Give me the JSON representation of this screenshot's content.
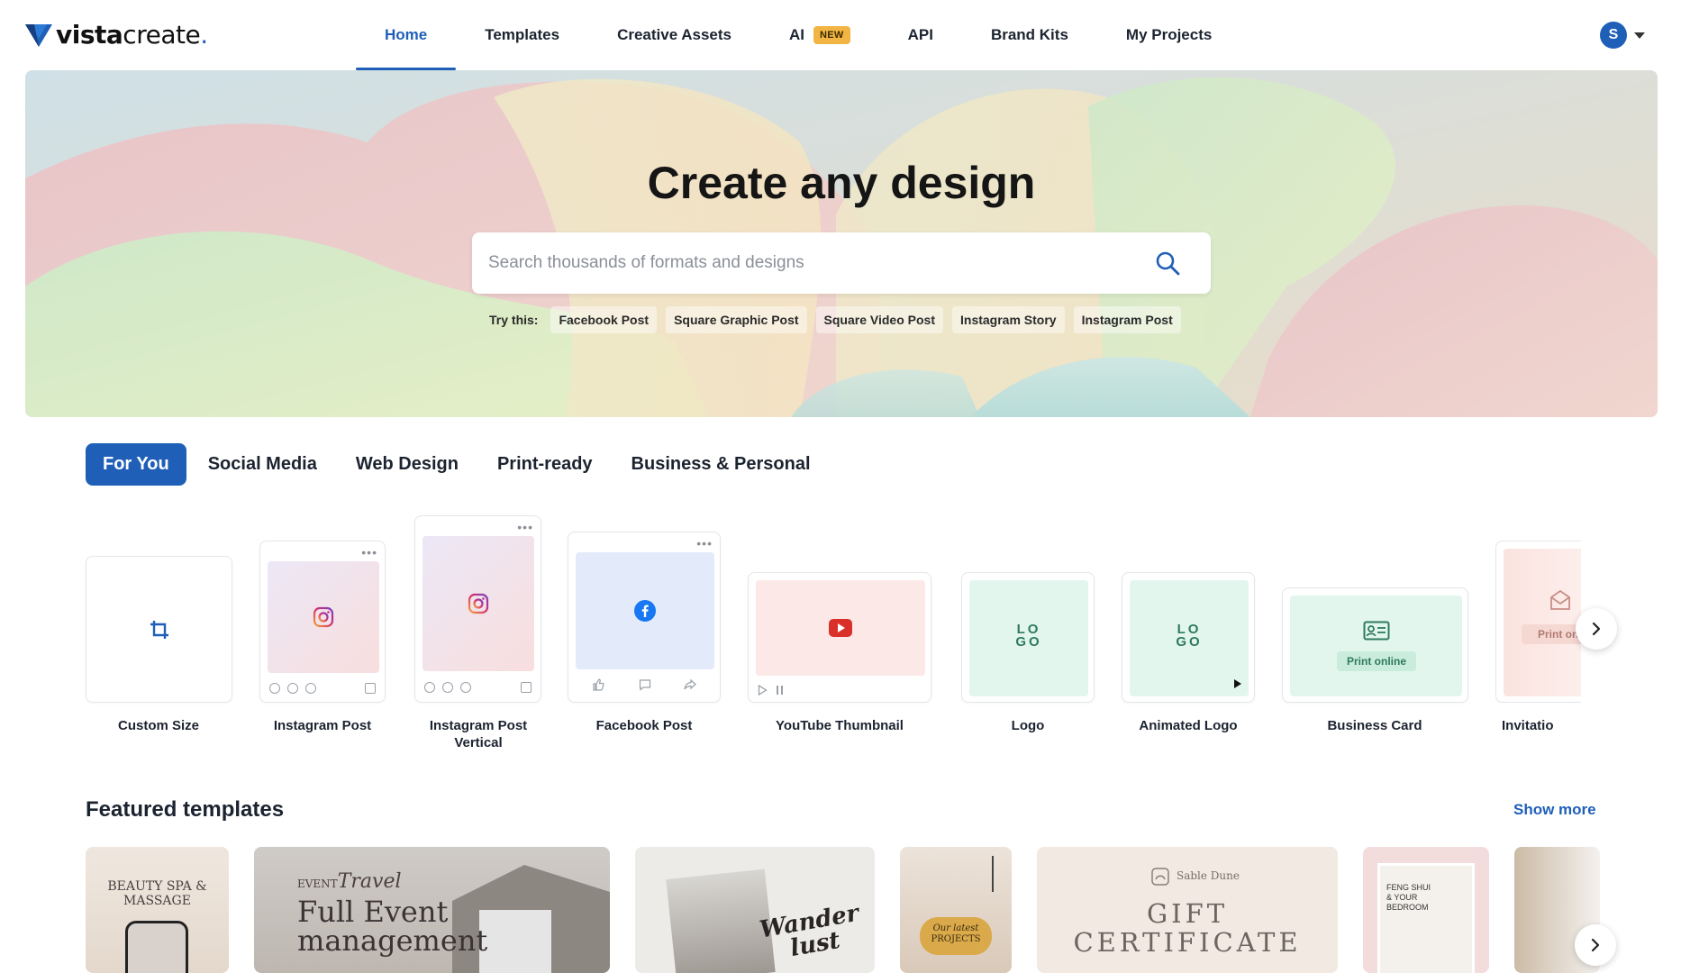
{
  "brand": {
    "name_bold": "vista",
    "name_light": "create",
    "name_dot": "."
  },
  "nav": {
    "items": [
      {
        "label": "Home",
        "active": true
      },
      {
        "label": "Templates"
      },
      {
        "label": "Creative Assets"
      },
      {
        "label": "AI",
        "badge": "NEW"
      },
      {
        "label": "API"
      },
      {
        "label": "Brand Kits"
      },
      {
        "label": "My Projects"
      }
    ]
  },
  "user": {
    "initial": "S"
  },
  "hero": {
    "title": "Create any design",
    "search_placeholder": "Search thousands of formats and designs",
    "try_label": "Try this:",
    "suggestions": [
      "Facebook Post",
      "Square Graphic Post",
      "Square Video Post",
      "Instagram Story",
      "Instagram Post"
    ]
  },
  "categories": {
    "tabs": [
      {
        "label": "For You",
        "active": true
      },
      {
        "label": "Social Media"
      },
      {
        "label": "Web Design"
      },
      {
        "label": "Print-ready"
      },
      {
        "label": "Business & Personal"
      }
    ]
  },
  "formats": [
    {
      "label": "Custom Size",
      "icon": "crop-icon"
    },
    {
      "label": "Instagram Post",
      "icon": "instagram-icon"
    },
    {
      "label": "Instagram Post Vertical",
      "label_line1": "Instagram Post",
      "label_line2": "Vertical",
      "icon": "instagram-icon"
    },
    {
      "label": "Facebook Post",
      "icon": "facebook-icon"
    },
    {
      "label": "YouTube Thumbnail",
      "icon": "youtube-icon"
    },
    {
      "label": "Logo",
      "icon": "logo-text-icon",
      "logo_text_1": "LO",
      "logo_text_2": "GO"
    },
    {
      "label": "Animated Logo",
      "icon": "logo-text-icon",
      "logo_text_1": "LO",
      "logo_text_2": "GO"
    },
    {
      "label": "Business Card",
      "icon": "id-card-icon",
      "pill": "Print online"
    },
    {
      "label": "Invitation",
      "label_visible": "Invitatio",
      "icon": "envelope-icon",
      "pill": "Print onli"
    }
  ],
  "featured": {
    "title": "Featured templates",
    "show_more": "Show more",
    "templates": [
      {
        "text": "BEAUTY SPA & MASSAGE"
      },
      {
        "text_small": "EVENT",
        "text_script": "Travel",
        "text_main1": "Full Event",
        "text_main2": "management"
      },
      {
        "text_script1": "Wander",
        "text_script2": "lust"
      },
      {
        "text1": "Our latest",
        "text2": "PROJECTS"
      },
      {
        "brand": "Sable Dune",
        "text1": "GIFT",
        "text2": "CERTIFICATE"
      },
      {
        "text1": "FENG SHUI",
        "text2": "& YOUR",
        "text3": "BEDROOM"
      },
      {
        "text": ""
      }
    ]
  },
  "colors": {
    "accent": "#1f5fb8",
    "badge": "#f2b544"
  }
}
